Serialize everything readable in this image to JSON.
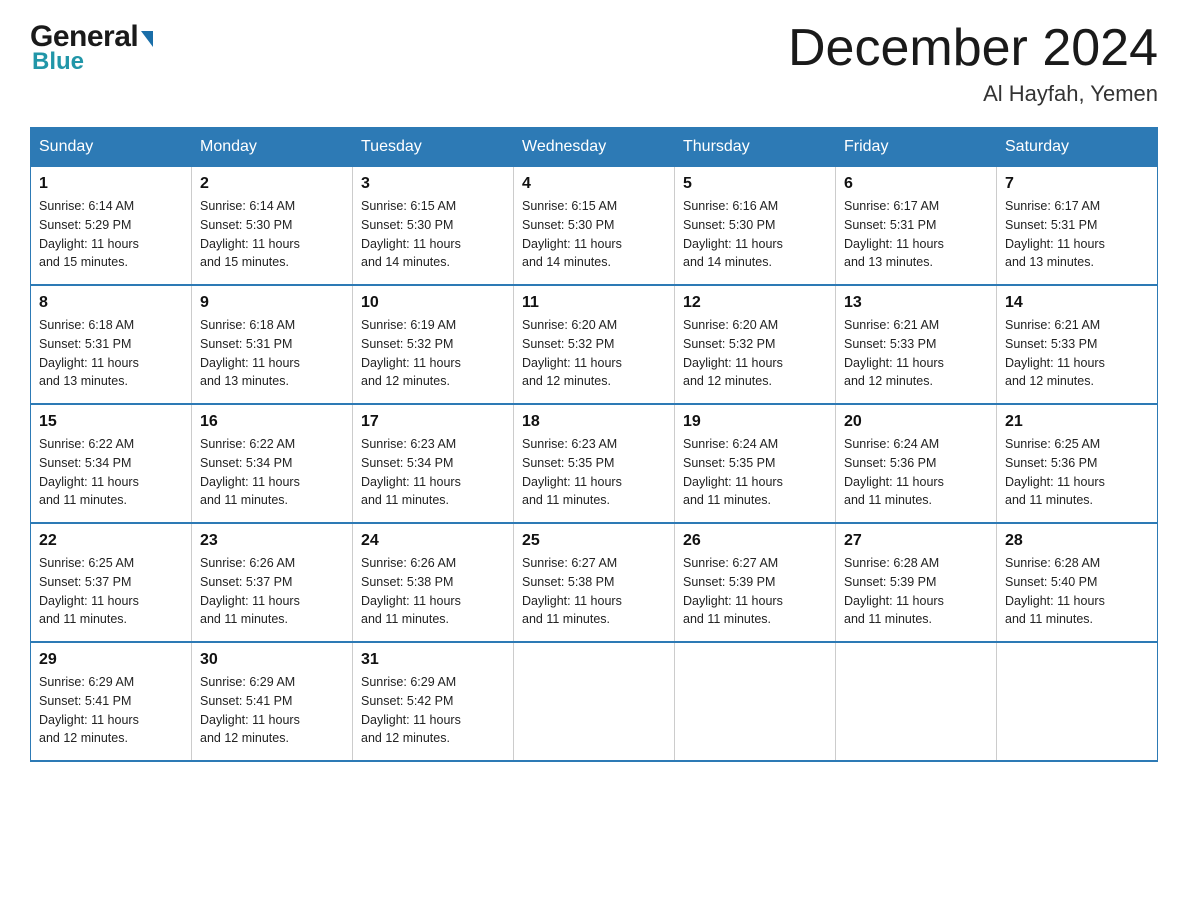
{
  "logo": {
    "general": "General",
    "triangle": "▶",
    "blue": "Blue"
  },
  "title": "December 2024",
  "location": "Al Hayfah, Yemen",
  "days_of_week": [
    "Sunday",
    "Monday",
    "Tuesday",
    "Wednesday",
    "Thursday",
    "Friday",
    "Saturday"
  ],
  "weeks": [
    [
      {
        "day": "1",
        "sunrise": "6:14 AM",
        "sunset": "5:29 PM",
        "daylight": "11 hours and 15 minutes."
      },
      {
        "day": "2",
        "sunrise": "6:14 AM",
        "sunset": "5:30 PM",
        "daylight": "11 hours and 15 minutes."
      },
      {
        "day": "3",
        "sunrise": "6:15 AM",
        "sunset": "5:30 PM",
        "daylight": "11 hours and 14 minutes."
      },
      {
        "day": "4",
        "sunrise": "6:15 AM",
        "sunset": "5:30 PM",
        "daylight": "11 hours and 14 minutes."
      },
      {
        "day": "5",
        "sunrise": "6:16 AM",
        "sunset": "5:30 PM",
        "daylight": "11 hours and 14 minutes."
      },
      {
        "day": "6",
        "sunrise": "6:17 AM",
        "sunset": "5:31 PM",
        "daylight": "11 hours and 13 minutes."
      },
      {
        "day": "7",
        "sunrise": "6:17 AM",
        "sunset": "5:31 PM",
        "daylight": "11 hours and 13 minutes."
      }
    ],
    [
      {
        "day": "8",
        "sunrise": "6:18 AM",
        "sunset": "5:31 PM",
        "daylight": "11 hours and 13 minutes."
      },
      {
        "day": "9",
        "sunrise": "6:18 AM",
        "sunset": "5:31 PM",
        "daylight": "11 hours and 13 minutes."
      },
      {
        "day": "10",
        "sunrise": "6:19 AM",
        "sunset": "5:32 PM",
        "daylight": "11 hours and 12 minutes."
      },
      {
        "day": "11",
        "sunrise": "6:20 AM",
        "sunset": "5:32 PM",
        "daylight": "11 hours and 12 minutes."
      },
      {
        "day": "12",
        "sunrise": "6:20 AM",
        "sunset": "5:32 PM",
        "daylight": "11 hours and 12 minutes."
      },
      {
        "day": "13",
        "sunrise": "6:21 AM",
        "sunset": "5:33 PM",
        "daylight": "11 hours and 12 minutes."
      },
      {
        "day": "14",
        "sunrise": "6:21 AM",
        "sunset": "5:33 PM",
        "daylight": "11 hours and 12 minutes."
      }
    ],
    [
      {
        "day": "15",
        "sunrise": "6:22 AM",
        "sunset": "5:34 PM",
        "daylight": "11 hours and 11 minutes."
      },
      {
        "day": "16",
        "sunrise": "6:22 AM",
        "sunset": "5:34 PM",
        "daylight": "11 hours and 11 minutes."
      },
      {
        "day": "17",
        "sunrise": "6:23 AM",
        "sunset": "5:34 PM",
        "daylight": "11 hours and 11 minutes."
      },
      {
        "day": "18",
        "sunrise": "6:23 AM",
        "sunset": "5:35 PM",
        "daylight": "11 hours and 11 minutes."
      },
      {
        "day": "19",
        "sunrise": "6:24 AM",
        "sunset": "5:35 PM",
        "daylight": "11 hours and 11 minutes."
      },
      {
        "day": "20",
        "sunrise": "6:24 AM",
        "sunset": "5:36 PM",
        "daylight": "11 hours and 11 minutes."
      },
      {
        "day": "21",
        "sunrise": "6:25 AM",
        "sunset": "5:36 PM",
        "daylight": "11 hours and 11 minutes."
      }
    ],
    [
      {
        "day": "22",
        "sunrise": "6:25 AM",
        "sunset": "5:37 PM",
        "daylight": "11 hours and 11 minutes."
      },
      {
        "day": "23",
        "sunrise": "6:26 AM",
        "sunset": "5:37 PM",
        "daylight": "11 hours and 11 minutes."
      },
      {
        "day": "24",
        "sunrise": "6:26 AM",
        "sunset": "5:38 PM",
        "daylight": "11 hours and 11 minutes."
      },
      {
        "day": "25",
        "sunrise": "6:27 AM",
        "sunset": "5:38 PM",
        "daylight": "11 hours and 11 minutes."
      },
      {
        "day": "26",
        "sunrise": "6:27 AM",
        "sunset": "5:39 PM",
        "daylight": "11 hours and 11 minutes."
      },
      {
        "day": "27",
        "sunrise": "6:28 AM",
        "sunset": "5:39 PM",
        "daylight": "11 hours and 11 minutes."
      },
      {
        "day": "28",
        "sunrise": "6:28 AM",
        "sunset": "5:40 PM",
        "daylight": "11 hours and 11 minutes."
      }
    ],
    [
      {
        "day": "29",
        "sunrise": "6:29 AM",
        "sunset": "5:41 PM",
        "daylight": "11 hours and 12 minutes."
      },
      {
        "day": "30",
        "sunrise": "6:29 AM",
        "sunset": "5:41 PM",
        "daylight": "11 hours and 12 minutes."
      },
      {
        "day": "31",
        "sunrise": "6:29 AM",
        "sunset": "5:42 PM",
        "daylight": "11 hours and 12 minutes."
      },
      null,
      null,
      null,
      null
    ]
  ],
  "labels": {
    "sunrise_prefix": "Sunrise: ",
    "sunset_prefix": "Sunset: ",
    "daylight_prefix": "Daylight: "
  }
}
